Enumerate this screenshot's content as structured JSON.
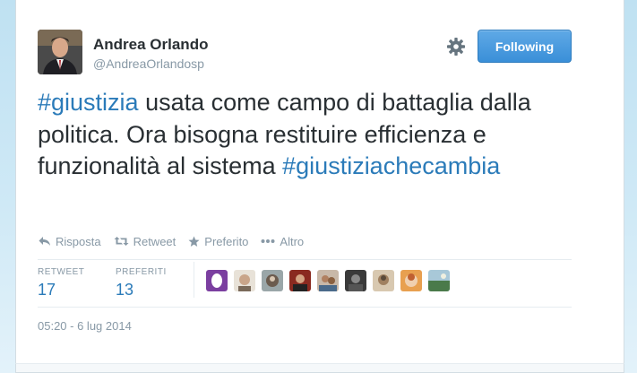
{
  "tweet": {
    "author": {
      "fullname": "Andrea Orlando",
      "username": "@AndreaOrlandosp"
    },
    "follow_button": {
      "label": "Following"
    },
    "text_parts": [
      {
        "type": "hashtag",
        "text": "#giustizia"
      },
      {
        "type": "text",
        "text": " usata come campo di battaglia dalla politica. Ora bisogna restituire efficienza e funzionalità al sistema "
      },
      {
        "type": "hashtag",
        "text": "#giustiziachecambia"
      }
    ],
    "actions": {
      "reply": "Risposta",
      "retweet": "Retweet",
      "favorite": "Preferito",
      "more": "Altro"
    },
    "stats": {
      "retweets_label": "RETWEET",
      "retweets_value": "17",
      "favorites_label": "PREFERITI",
      "favorites_value": "13"
    },
    "facepile_count": 9,
    "timestamp": "05:20 - 6 lug 2014"
  },
  "colors": {
    "link": "#2b7bb9",
    "muted": "#8899a6",
    "follow_button": "#3a8fd8",
    "text": "#292f33"
  },
  "icons": [
    "gear-icon",
    "reply-icon",
    "retweet-icon",
    "star-icon",
    "more-icon"
  ]
}
